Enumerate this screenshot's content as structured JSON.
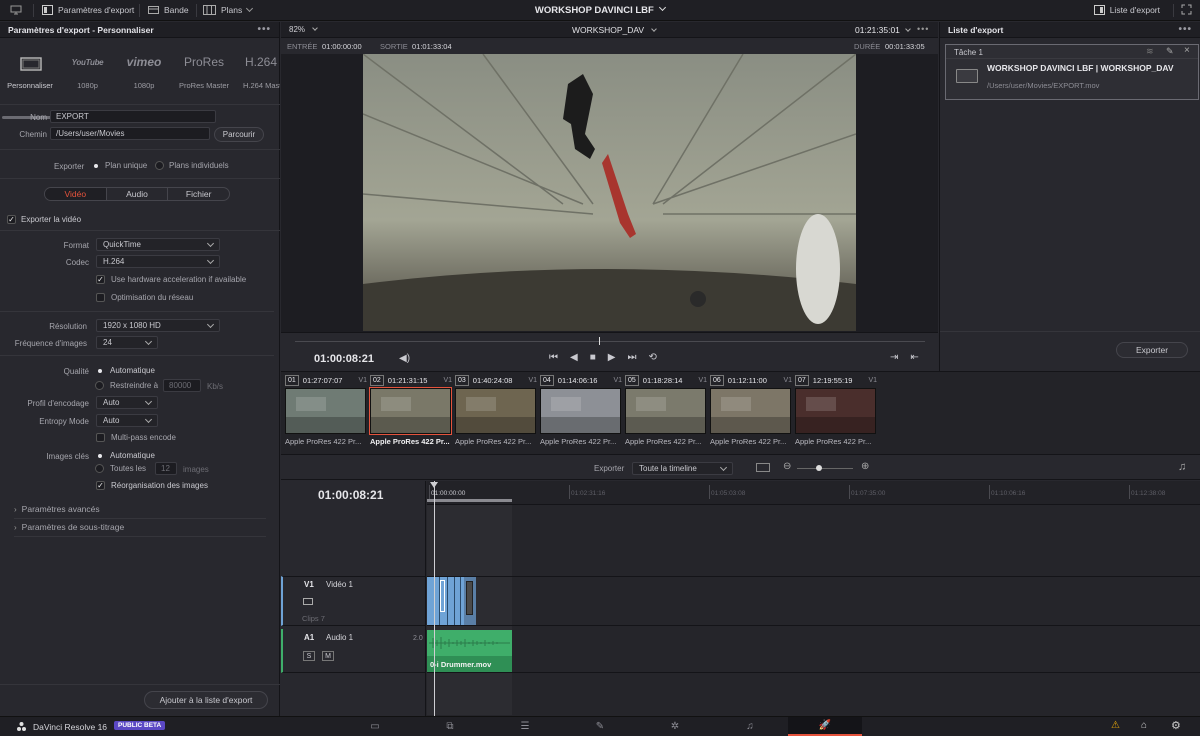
{
  "topbar": {
    "export_params": "Paramètres d'export",
    "band": "Bande",
    "plans": "Plans",
    "project_title": "WORKSHOP DAVINCI LBF",
    "export_list": "Liste d'export"
  },
  "left": {
    "header": "Paramètres d'export - Personnaliser",
    "presets": [
      {
        "logo": "▭",
        "name": "Personnaliser"
      },
      {
        "logo": "YouTube",
        "name": "1080p"
      },
      {
        "logo": "vimeo",
        "name": "1080p"
      },
      {
        "logo": "ProRes",
        "name": "ProRes Master"
      },
      {
        "logo": "H.264",
        "name": "H.264 Master"
      }
    ],
    "name_label": "Nom",
    "name_value": "EXPORT",
    "path_label": "Chemin",
    "path_value": "/Users/user/Movies",
    "browse": "Parcourir",
    "export_label": "Exporter",
    "single_clip": "Plan unique",
    "individual_clips": "Plans individuels",
    "tabs": [
      "Vidéo",
      "Audio",
      "Fichier"
    ],
    "export_video": "Exporter la vidéo",
    "format_label": "Format",
    "format_value": "QuickTime",
    "codec_label": "Codec",
    "codec_value": "H.264",
    "hw_accel": "Use hardware acceleration if available",
    "net_opt": "Optimisation du réseau",
    "resolution_label": "Résolution",
    "resolution_value": "1920 x 1080 HD",
    "fps_label": "Fréquence d'images",
    "fps_value": "24",
    "quality_label": "Qualité",
    "quality_auto": "Automatique",
    "restrict_to": "Restreindre à",
    "restrict_value": "80000",
    "restrict_unit": "Kb/s",
    "encode_profile_label": "Profil d'encodage",
    "encode_profile_value": "Auto",
    "entropy_label": "Entropy Mode",
    "entropy_value": "Auto",
    "multipass": "Multi-pass encode",
    "keyframes_label": "Images clés",
    "keyframes_auto": "Automatique",
    "every_label": "Toutes les",
    "every_value": "12",
    "every_unit": "images",
    "reorder": "Réorganisation des images",
    "advanced": "Paramètres avancés",
    "subtitles": "Paramètres de sous-titrage",
    "add_to_list": "Ajouter à la liste d'export"
  },
  "viewer": {
    "zoom": "82%",
    "timeline_name": "WORKSHOP_DAV",
    "timecode_total": "01:21:35:01",
    "in_label": "ENTRÉE",
    "in_value": "01:00:00:00",
    "out_label": "SORTIE",
    "out_value": "01:01:33:04",
    "duration_label": "DURÉE",
    "duration_value": "00:01:33:05",
    "current_tc": "01:00:08:21"
  },
  "queue": {
    "header": "Liste d'export",
    "job_label": "Tâche 1",
    "job_title": "WORKSHOP DAVINCI LBF | WORKSHOP_DAV",
    "job_path": "/Users/user/Movies/EXPORT.mov",
    "export_button": "Exporter"
  },
  "clips": [
    {
      "num": "01",
      "tc": "01:27:07:07",
      "track": "V1",
      "name": "Apple ProRes 422 Pr...",
      "color": "#6f7b74"
    },
    {
      "num": "02",
      "tc": "01:21:31:15",
      "track": "V1",
      "name": "Apple ProRes 422 Pr...",
      "color": "#7a7868",
      "selected": true
    },
    {
      "num": "03",
      "tc": "01:40:24:08",
      "track": "V1",
      "name": "Apple ProRes 422 Pr...",
      "color": "#6e6550"
    },
    {
      "num": "04",
      "tc": "01:14:06:16",
      "track": "V1",
      "name": "Apple ProRes 422 Pr...",
      "color": "#8d9096"
    },
    {
      "num": "05",
      "tc": "01:18:28:14",
      "track": "V1",
      "name": "Apple ProRes 422 Pr...",
      "color": "#7b7a6c"
    },
    {
      "num": "06",
      "tc": "01:12:11:00",
      "track": "V1",
      "name": "Apple ProRes 422 Pr...",
      "color": "#7d7667"
    },
    {
      "num": "07",
      "tc": "12:19:55:19",
      "track": "V1",
      "name": "Apple ProRes 422 Pr...",
      "color": "#4a2e2c"
    }
  ],
  "timeline": {
    "export_label": "Exporter",
    "range_value": "Toute la timeline",
    "tc": "01:00:08:21",
    "ruler": [
      "01:00:00:00",
      "01:02:31:16",
      "01:05:03:08",
      "01:07:35:00",
      "01:10:06:16",
      "01:12:38:08"
    ],
    "v1_label": "V1",
    "v1_name": "Vidéo 1",
    "v1_clips": "Clips 7",
    "a1_label": "A1",
    "a1_name": "Audio 1",
    "a1_level": "2.0",
    "a1_clip": "0-i Drummer.mov",
    "solo": "S",
    "mute": "M"
  },
  "bottom": {
    "app_name": "DaVinci Resolve 16",
    "beta": "PUBLIC BETA"
  },
  "colors": {
    "accent_red": "#e5533c",
    "video_clip": "#6fa3d6",
    "audio_clip": "#3fae6a",
    "beta_badge": "#5b48c4"
  }
}
